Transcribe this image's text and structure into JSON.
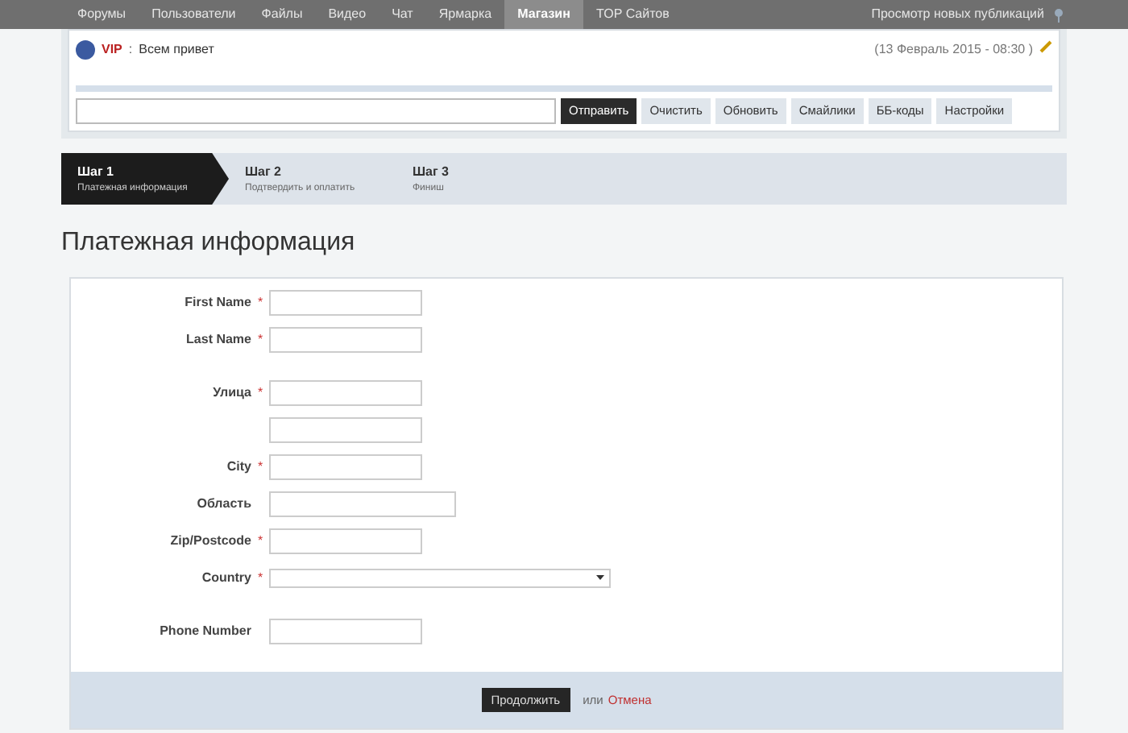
{
  "nav": {
    "items": [
      {
        "label": "Форумы",
        "selected": false
      },
      {
        "label": "Пользователи",
        "selected": false
      },
      {
        "label": "Файлы",
        "selected": false
      },
      {
        "label": "Видео",
        "selected": false
      },
      {
        "label": "Чат",
        "selected": false
      },
      {
        "label": "Ярмарка",
        "selected": false
      },
      {
        "label": "Магазин",
        "selected": true
      },
      {
        "label": "TOP Сайтов",
        "selected": false
      }
    ],
    "right_link": "Просмотр новых публикаций"
  },
  "chat": {
    "message": {
      "user": "VIP",
      "separator": ":",
      "text": "Всем привет",
      "time": "(13 Февраль 2015 - 08:30 )"
    },
    "send_button": "Отправить",
    "buttons": [
      "Очистить",
      "Обновить",
      "Смайлики",
      "ББ-коды",
      "Настройки"
    ]
  },
  "steps": [
    {
      "title": "Шаг 1",
      "subtitle": "Платежная информация",
      "selected": true
    },
    {
      "title": "Шаг 2",
      "subtitle": "Подтвердить и оплатить",
      "selected": false
    },
    {
      "title": "Шаг 3",
      "subtitle": "Финиш",
      "selected": false
    }
  ],
  "heading": "Платежная информация",
  "form": {
    "groups": [
      [
        {
          "label": "First Name",
          "required": true,
          "kind": "text"
        },
        {
          "label": "Last Name",
          "required": true,
          "kind": "text"
        }
      ],
      [
        {
          "label": "Улица",
          "required": true,
          "kind": "text"
        },
        {
          "required": false,
          "kind": "text"
        },
        {
          "label": "City",
          "required": true,
          "kind": "text"
        },
        {
          "label": "Область",
          "required": false,
          "kind": "wide"
        },
        {
          "label": "Zip/Postcode",
          "required": true,
          "kind": "text"
        },
        {
          "label": "Country",
          "required": true,
          "kind": "select"
        }
      ],
      [
        {
          "label": "Phone Number",
          "required": false,
          "kind": "text"
        }
      ]
    ],
    "required_mark": "*",
    "submit": "Продолжить",
    "or": "или",
    "cancel": "Отмена"
  }
}
